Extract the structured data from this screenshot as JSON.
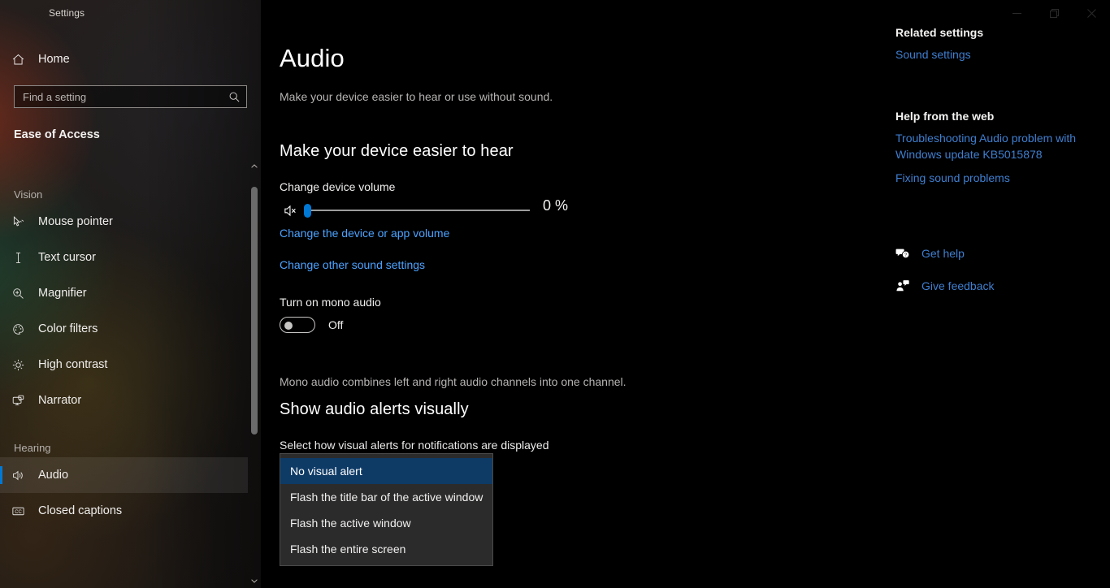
{
  "window": {
    "title": "Settings",
    "controls": [
      {
        "name": "minimize",
        "label": "Minimize"
      },
      {
        "name": "restore",
        "label": "Restore"
      },
      {
        "name": "close",
        "label": "Close"
      }
    ]
  },
  "sidebar": {
    "home_label": "Home",
    "home_icon": "home-icon",
    "search": {
      "placeholder": "Find a setting",
      "value": "",
      "icon": "search-icon"
    },
    "app_title": "Ease of Access",
    "groups": [
      {
        "label": "Vision",
        "items": [
          {
            "label": "Mouse pointer",
            "icon": "mouse-pointer-icon",
            "selected": false
          },
          {
            "label": "Text cursor",
            "icon": "text-cursor-icon",
            "selected": false
          },
          {
            "label": "Magnifier",
            "icon": "magnifier-icon",
            "selected": false
          },
          {
            "label": "Color filters",
            "icon": "palette-icon",
            "selected": false
          },
          {
            "label": "High contrast",
            "icon": "brightness-icon",
            "selected": false
          },
          {
            "label": "Narrator",
            "icon": "narrator-icon",
            "selected": false
          }
        ]
      },
      {
        "label": "Hearing",
        "items": [
          {
            "label": "Audio",
            "icon": "speaker-icon",
            "selected": true
          },
          {
            "label": "Closed captions",
            "icon": "closed-caption-icon",
            "selected": false
          }
        ]
      }
    ],
    "scrollbar": {
      "up_icon": "chevron-up-icon",
      "down_icon": "chevron-down-icon"
    }
  },
  "main": {
    "title": "Audio",
    "subtitle": "Make your device easier to hear or use without sound.",
    "hearing_section": {
      "heading": "Make your device easier to hear",
      "volume_label": "Change device volume",
      "volume_value": "0 %",
      "volume_percent": 0,
      "mute_icon": "speaker-mute-icon",
      "links": [
        "Change the device or app volume",
        "Change other sound settings"
      ],
      "mono_label": "Turn on mono audio",
      "mono_state": "Off",
      "mono_on": false,
      "mono_description": "Mono audio combines left and right audio channels into one channel."
    },
    "alerts_section": {
      "heading": "Show audio alerts visually",
      "label": "Select how visual alerts for notifications are displayed",
      "selected_option": "No visual alert",
      "options": [
        "No visual alert",
        "Flash the title bar of the active window",
        "Flash the active window",
        "Flash the entire screen"
      ]
    }
  },
  "rail": {
    "related_heading": "Related settings",
    "related_links": [
      "Sound settings"
    ],
    "help_heading": "Help from the web",
    "help_links": [
      "Troubleshooting Audio problem with Windows update KB5015878",
      "Fixing sound problems"
    ],
    "actions": [
      {
        "label": "Get help",
        "icon": "get-help-icon"
      },
      {
        "label": "Give feedback",
        "icon": "give-feedback-icon"
      }
    ]
  },
  "colors": {
    "accent": "#0078d4",
    "link": "#4da3ff",
    "rail_link": "#3f7fd0",
    "selected_option": "#0e3a66",
    "background": "#000000"
  }
}
